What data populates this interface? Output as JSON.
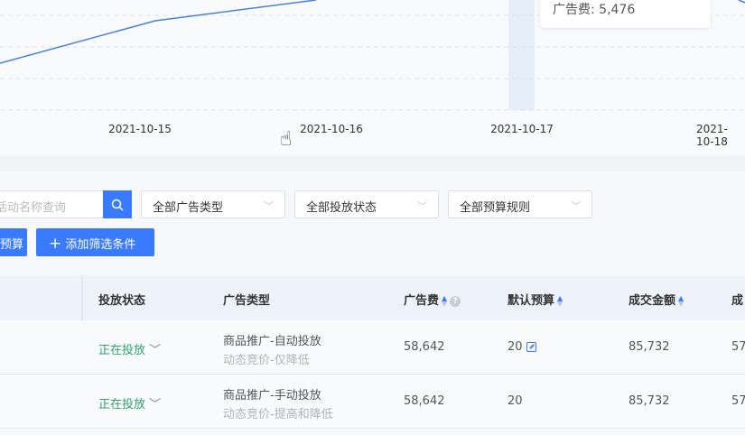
{
  "chart": {
    "x_labels": [
      "2021-10-15",
      "2021-10-16",
      "2021-10-17",
      "2021-10-18"
    ],
    "tooltip": {
      "label": "广告费:",
      "value": "5,476"
    }
  },
  "filters": {
    "search_placeholder": "活动名称查询",
    "selects": [
      "全部广告类型",
      "全部投放状态",
      "全部预算规则"
    ],
    "budget_button": "预算",
    "add_filter_button": "添加筛选条件"
  },
  "table": {
    "headers": [
      "投放状态",
      "广告类型",
      "广告费",
      "默认预算",
      "成交金额",
      "成"
    ],
    "rows": [
      {
        "status": "正在投放",
        "type": "商品推广-自动投放",
        "bid": "动态竞价-仅降低",
        "cost": "58,642",
        "budget": "20",
        "gmv": "85,732",
        "extra": "57"
      },
      {
        "status": "正在投放",
        "type": "商品推广-手动投放",
        "bid": "动态竞价-提高和降低",
        "cost": "58,642",
        "budget": "20",
        "gmv": "85,732",
        "extra": "57"
      }
    ]
  }
}
